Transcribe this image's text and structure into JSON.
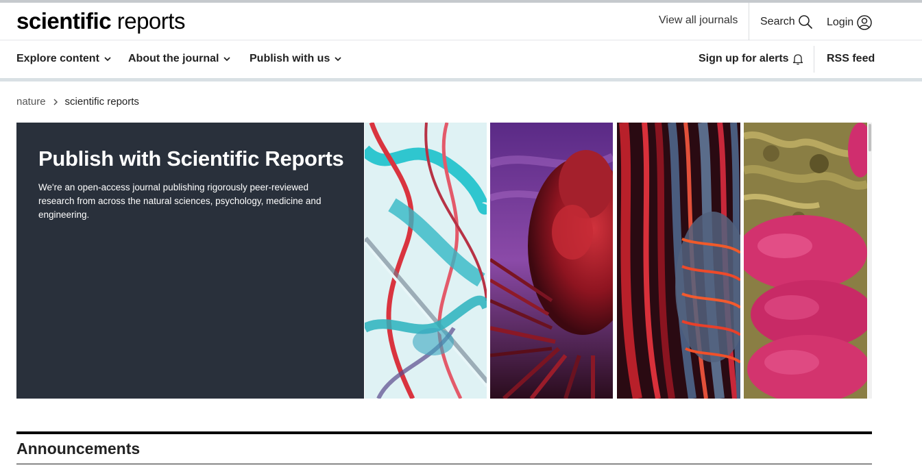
{
  "header": {
    "logo_bold": "scientific",
    "logo_light": "reports",
    "view_all_journals": "View all journals",
    "search_label": "Search",
    "login_label": "Login"
  },
  "nav": {
    "items": [
      {
        "label": "Explore content"
      },
      {
        "label": "About the journal"
      },
      {
        "label": "Publish with us"
      }
    ],
    "signup_label": "Sign up for alerts",
    "rss_label": "RSS feed"
  },
  "breadcrumb": {
    "root": "nature",
    "current": "scientific reports"
  },
  "hero": {
    "title": "Publish with Scientific Reports",
    "description": "We're an open-access journal publishing rigorously peer-reviewed research from across the natural sciences, psychology, medicine and engineering.",
    "panel_color": "#29303b",
    "images": [
      "glass-tubes-image",
      "red-organism-image",
      "fibrous-tissue-image",
      "pink-cells-image"
    ]
  },
  "announcements": {
    "heading": "Announcements"
  },
  "icons": {
    "search": "search-icon",
    "login": "user-circle-icon",
    "chevron": "chevron-down-icon",
    "bell": "bell-icon",
    "breadcrumb_sep": "chevron-right-icon"
  }
}
